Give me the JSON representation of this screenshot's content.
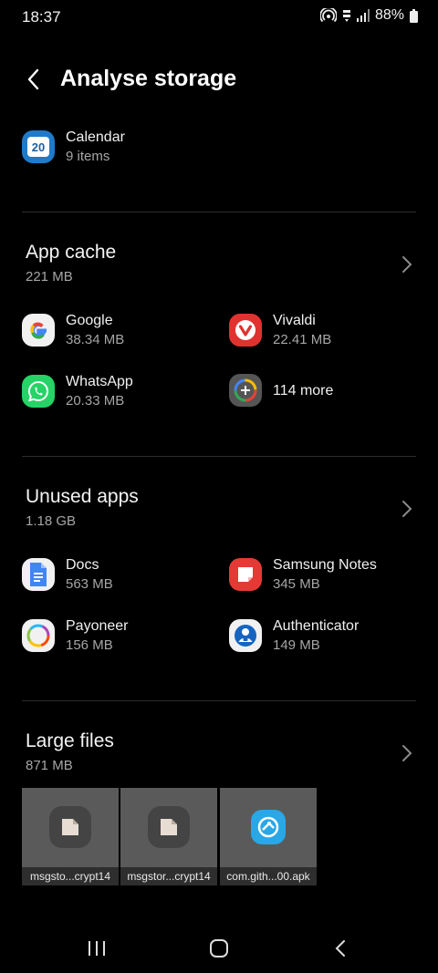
{
  "status_bar": {
    "time": "18:37",
    "battery": "88%"
  },
  "header": {
    "title": "Analyse storage"
  },
  "top_item": {
    "name": "Calendar",
    "size": "9 items",
    "icon": "calendar-icon",
    "icon_text": "20"
  },
  "app_cache": {
    "title": "App cache",
    "size": "221 MB",
    "items": [
      {
        "name": "Google",
        "size": "38.34 MB",
        "icon": "google-icon"
      },
      {
        "name": "Vivaldi",
        "size": "22.41 MB",
        "icon": "vivaldi-icon"
      },
      {
        "name": "WhatsApp",
        "size": "20.33 MB",
        "icon": "whatsapp-icon"
      },
      {
        "name": "114 more",
        "icon": "more-apps-icon"
      }
    ]
  },
  "unused_apps": {
    "title": "Unused apps",
    "size": "1.18 GB",
    "items": [
      {
        "name": "Docs",
        "size": "563 MB",
        "icon": "docs-icon"
      },
      {
        "name": "Samsung Notes",
        "size": "345 MB",
        "icon": "samsung-notes-icon"
      },
      {
        "name": "Payoneer",
        "size": "156 MB",
        "icon": "payoneer-icon"
      },
      {
        "name": "Authenticator",
        "size": "149 MB",
        "icon": "authenticator-icon"
      }
    ]
  },
  "large_files": {
    "title": "Large files",
    "size": "871 MB",
    "files": [
      {
        "name": "msgsto...crypt14",
        "icon": "file-icon"
      },
      {
        "name": "msgstor...crypt14",
        "icon": "file-icon"
      },
      {
        "name": "com.gith...00.apk",
        "icon": "apk-icon"
      }
    ]
  },
  "colors": {
    "background": "#000000",
    "secondary_text": "#a6a6a6",
    "divider": "#2c2c2c"
  }
}
